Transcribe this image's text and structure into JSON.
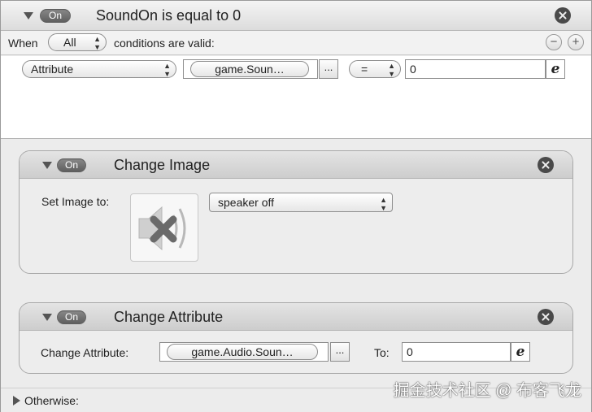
{
  "rule": {
    "on_label": "On",
    "title": "SoundOn is equal to 0",
    "when_label": "When",
    "when_select": "All",
    "conditions_label": "conditions are valid:",
    "remove_symbol": "−",
    "add_symbol": "+",
    "condition": {
      "type_select": "Attribute",
      "attribute_ref": "game.Soun…",
      "ellipsis": "...",
      "operator": "=",
      "value": "0",
      "expression_glyph": "e"
    }
  },
  "change_image": {
    "on_label": "On",
    "title": "Change Image",
    "set_label": "Set Image to:",
    "image_icon": "speaker-off-icon",
    "image_select": "speaker off"
  },
  "change_attribute": {
    "on_label": "On",
    "title": "Change Attribute",
    "attr_label": "Change Attribute:",
    "attribute_ref": "game.Audio.Soun…",
    "ellipsis": "...",
    "to_label": "To:",
    "value": "0",
    "expression_glyph": "e"
  },
  "otherwise": {
    "label": "Otherwise:"
  },
  "watermark": "掘金技术社区 @ 布客飞龙"
}
